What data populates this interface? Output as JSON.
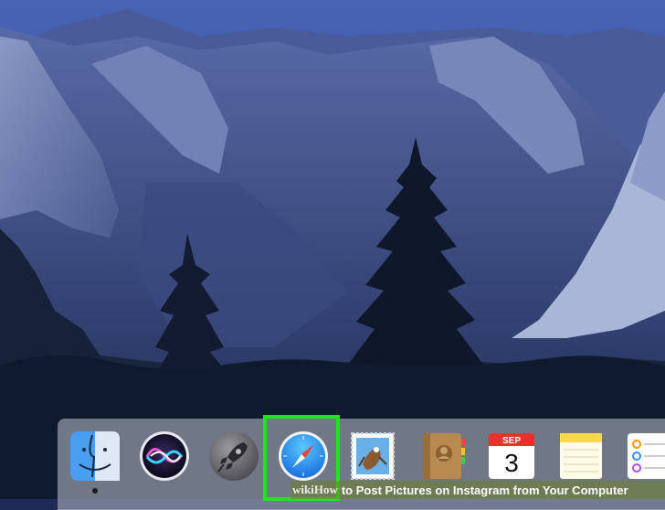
{
  "desktop": {
    "wallpaper": "mountain-valley-dusk"
  },
  "dock": {
    "items": [
      {
        "name": "Finder",
        "icon": "finder-icon",
        "running": true
      },
      {
        "name": "Siri",
        "icon": "siri-icon",
        "running": false
      },
      {
        "name": "Launchpad",
        "icon": "launchpad-rocket-icon",
        "running": false
      },
      {
        "name": "Safari",
        "icon": "safari-compass-icon",
        "running": false,
        "highlighted": true
      },
      {
        "name": "Mail",
        "icon": "mail-stamp-icon",
        "running": false
      },
      {
        "name": "Contacts",
        "icon": "contacts-book-icon",
        "running": false
      },
      {
        "name": "Calendar",
        "icon": "calendar-icon",
        "running": false
      },
      {
        "name": "Notes",
        "icon": "notes-icon",
        "running": false
      },
      {
        "name": "Reminders",
        "icon": "reminders-icon",
        "running": false
      }
    ],
    "calendar": {
      "month": "SEP",
      "day": "3"
    }
  },
  "caption": {
    "brand": "wiki",
    "how": "How",
    "title": "to Post Pictures on Instagram from Your Computer"
  },
  "colors": {
    "highlight": "#1ee61e",
    "dock_bg": "#969baa",
    "sky": "#3e5aa8"
  }
}
